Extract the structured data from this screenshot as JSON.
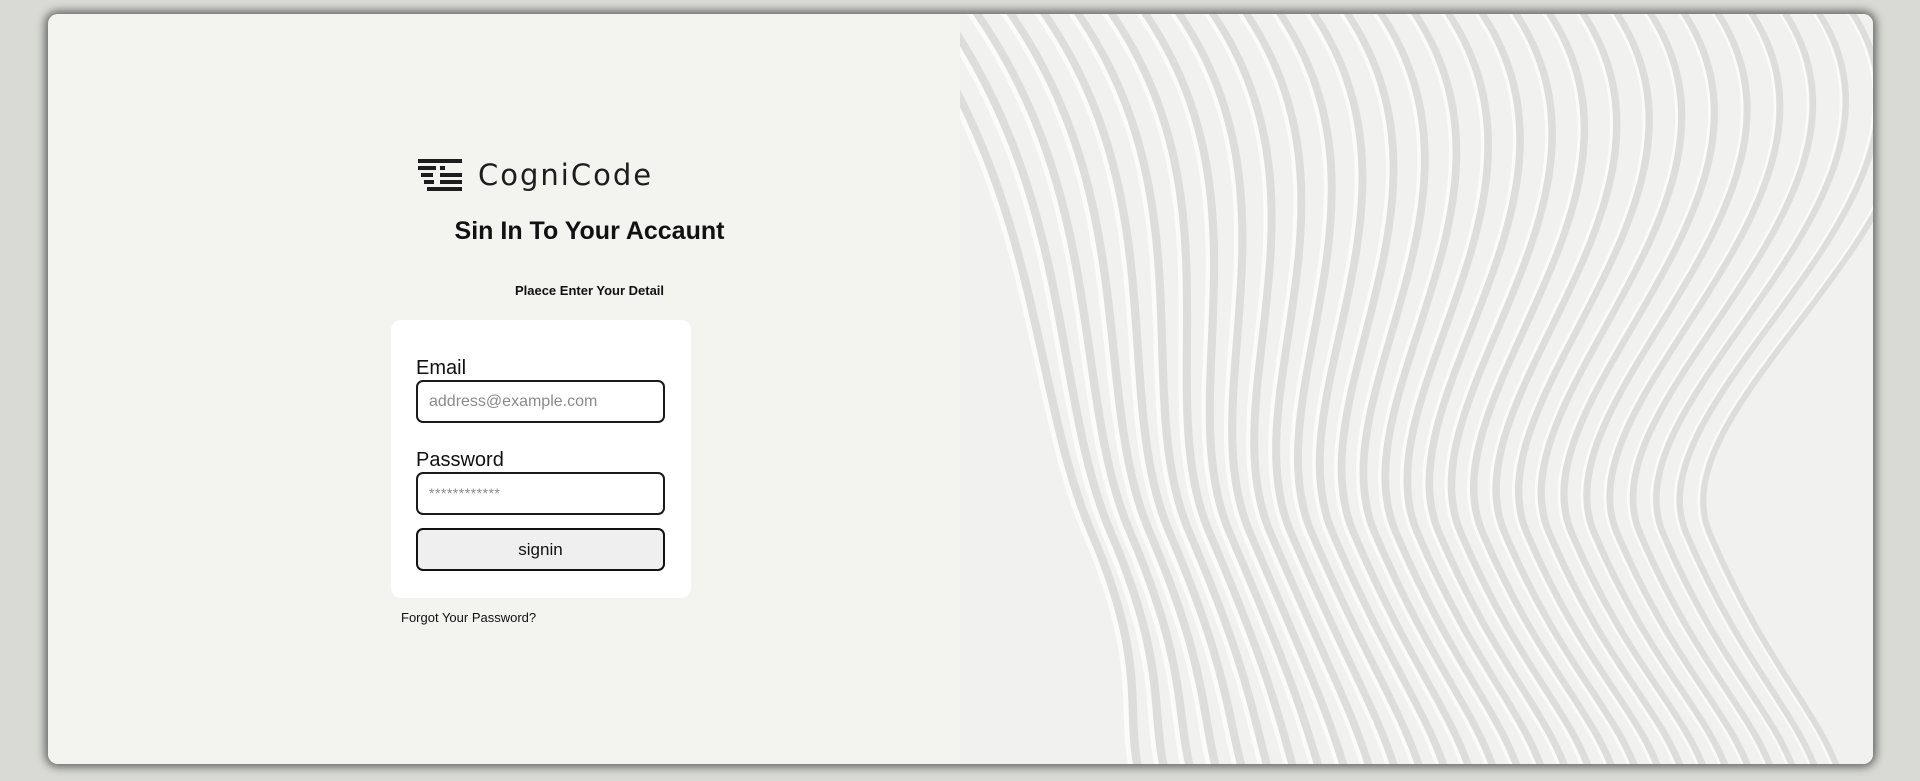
{
  "brand": {
    "logo_text": "CogniCode"
  },
  "login": {
    "title": "Sin In To Your Accaunt",
    "subtitle": "Plaece Enter Your Detail",
    "email": {
      "label": "Email",
      "value": "",
      "placeholder": "address@example.com"
    },
    "password": {
      "label": "Password",
      "value": "",
      "placeholder": "************"
    },
    "submit_label": "signin",
    "forgot_link": "Forgot Your Password?"
  },
  "colors": {
    "page_background": "#d9dad5",
    "panel_background": "#f3f3f0",
    "card_background": "#ffffff",
    "text": "#111111",
    "input_border": "#1a1a1a",
    "button_background": "#efefef"
  },
  "icons": {
    "logo": "stacked-lines-bracket-icon"
  }
}
